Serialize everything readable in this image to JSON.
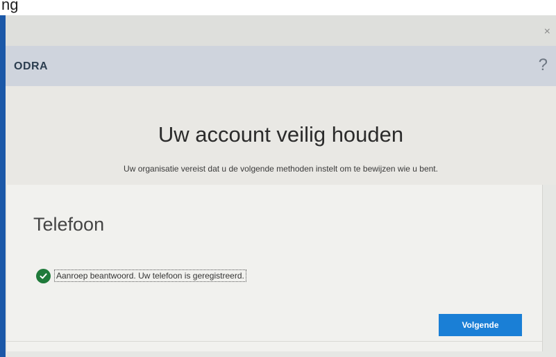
{
  "background_caption": "ng",
  "window": {
    "close_glyph": "×",
    "org_name": "ODRA",
    "help_glyph": "?",
    "title": "Uw account veilig houden",
    "subtitle": "Uw organisatie vereist dat u de volgende methoden instelt om te bewijzen wie u bent."
  },
  "section": {
    "title": "Telefoon",
    "status_icon": "check-circle-icon",
    "status_text": "Aanroep beantwoord. Uw telefoon is geregistreerd.",
    "next_label": "Volgende"
  },
  "colors": {
    "accent": "#1a7fd6",
    "success": "#1f7a3a",
    "desktop": "#1f5fb0"
  }
}
